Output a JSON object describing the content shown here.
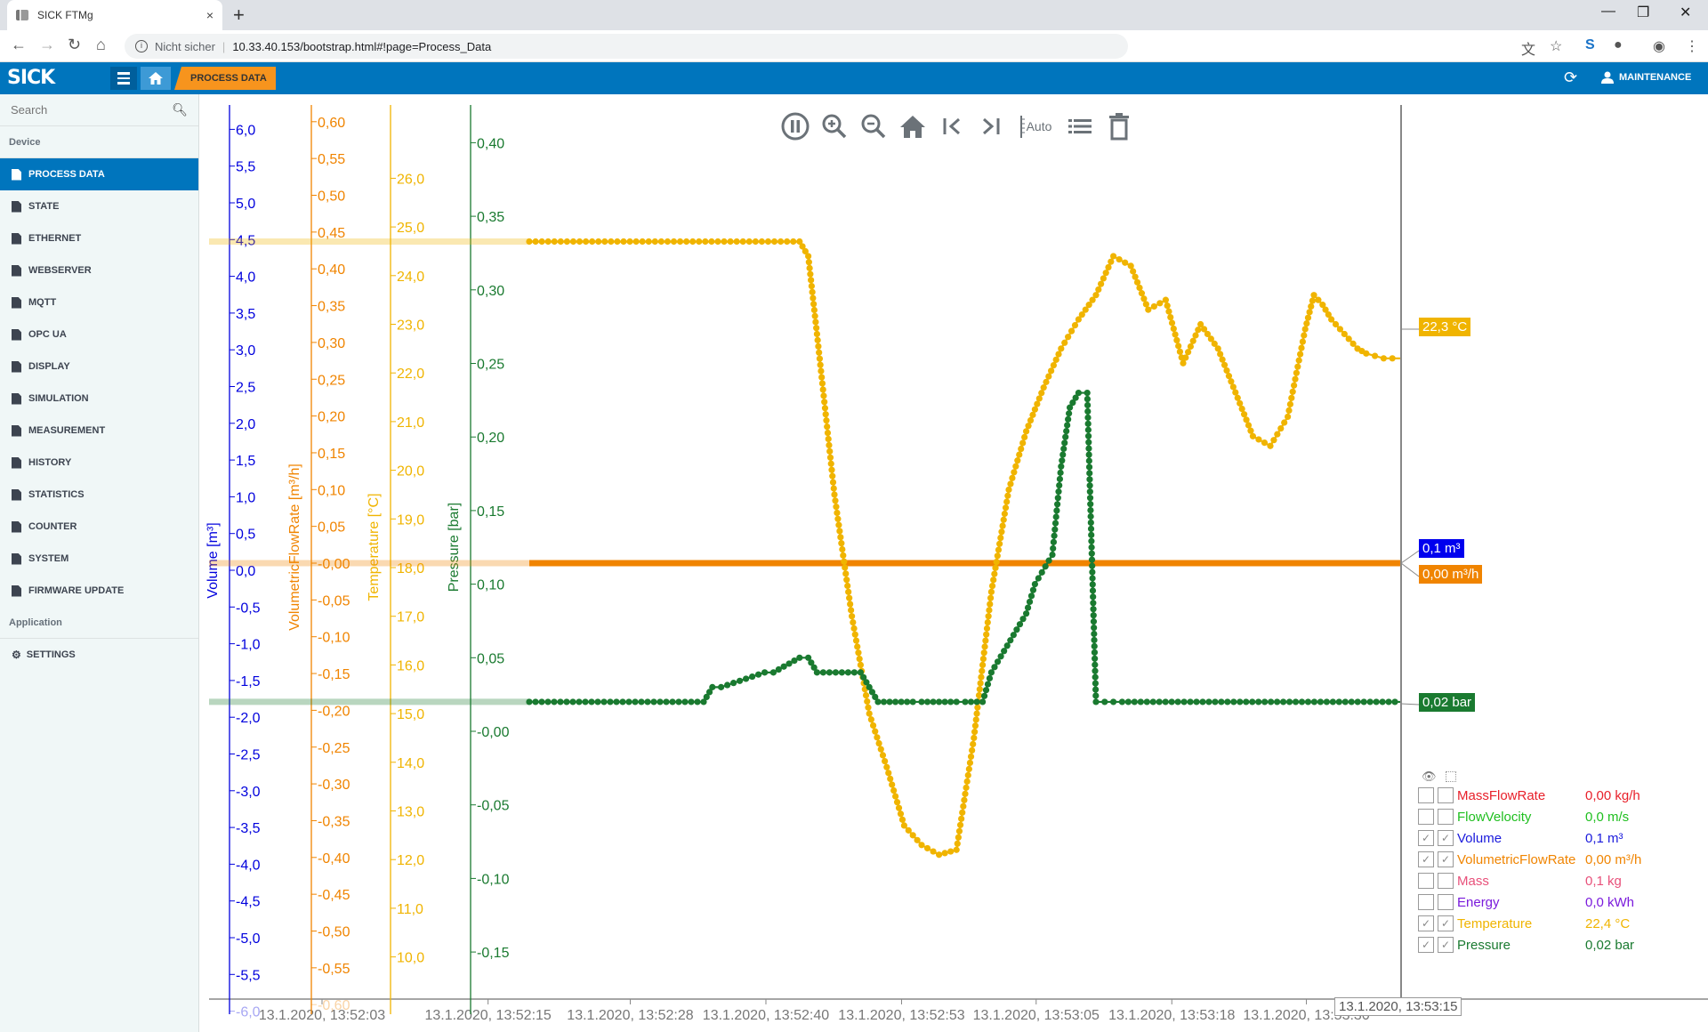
{
  "browser": {
    "tab_title": "SICK FTMg",
    "tab_close": "×",
    "new_tab": "+",
    "security_label": "Nicht sicher",
    "url": "10.33.40.153/bootstrap.html#!page=Process_Data",
    "window_controls": {
      "minimize": "—",
      "restore": "❐",
      "close": "✕"
    }
  },
  "header": {
    "logo": "SICK",
    "breadcrumb": "PROCESS DATA",
    "user_label": "MAINTENANCE"
  },
  "sidebar": {
    "search_placeholder": "Search",
    "device_section": "Device",
    "items": [
      {
        "label": "PROCESS DATA",
        "active": true
      },
      {
        "label": "STATE"
      },
      {
        "label": "ETHERNET"
      },
      {
        "label": "WEBSERVER"
      },
      {
        "label": "MQTT"
      },
      {
        "label": "OPC UA"
      },
      {
        "label": "DISPLAY"
      },
      {
        "label": "SIMULATION"
      },
      {
        "label": "MEASUREMENT"
      },
      {
        "label": "HISTORY"
      },
      {
        "label": "STATISTICS"
      },
      {
        "label": "COUNTER"
      },
      {
        "label": "SYSTEM"
      },
      {
        "label": "FIRMWARE UPDATE"
      }
    ],
    "application_section": "Application",
    "app_items": [
      {
        "label": "SETTINGS"
      }
    ]
  },
  "toolbar": {
    "auto_label": "Auto",
    "buttons": [
      "pause",
      "zoom-in",
      "zoom-out",
      "home",
      "jump-start",
      "jump-end",
      "auto-scale",
      "list",
      "delete"
    ]
  },
  "chart_data": {
    "type": "line",
    "xlabel": "",
    "x_ticks": [
      "13.1.2020, 13:52:03",
      "13.1.2020, 13:52:15",
      "13.1.2020, 13:52:28",
      "13.1.2020, 13:52:40",
      "13.1.2020, 13:52:53",
      "13.1.2020, 13:53:05",
      "13.1.2020, 13:53:18",
      "13.1.2020, 13:53:30"
    ],
    "x_range_seconds": [
      0,
      100
    ],
    "cursor_time": "13.1.2020, 13:53:15",
    "axes": [
      {
        "name": "Volume",
        "label": "Volume [m³]",
        "color": "#0000dd",
        "range": [
          -6.0,
          6.0
        ],
        "ticks": [
          "6,0",
          "5,5",
          "5,0",
          "4,5",
          "4,0",
          "3,5",
          "3,0",
          "2,5",
          "2,0",
          "1,5",
          "1,0",
          "0,5",
          "0,0",
          "-0,5",
          "-1,0",
          "-1,5",
          "-2,0",
          "-2,5",
          "-3,0",
          "-3,5",
          "-4,0",
          "-4,5",
          "-5,0",
          "-5,5",
          "-6,0"
        ]
      },
      {
        "name": "VolumetricFlowRate",
        "label": "VolumetricFlowRate [m³/h]",
        "color": "#f08400",
        "range": [
          -0.6,
          0.6
        ],
        "ticks": [
          "0,60",
          "0,55",
          "0,50",
          "0,45",
          "0,40",
          "0,35",
          "0,30",
          "0,25",
          "0,20",
          "0,15",
          "0,10",
          "0,05",
          "-0,00",
          "-0,05",
          "-0,10",
          "-0,15",
          "-0,20",
          "-0,25",
          "-0,30",
          "-0,35",
          "-0,40",
          "-0,45",
          "-0,50",
          "-0,55",
          "-0,60"
        ]
      },
      {
        "name": "Temperature",
        "label": "Temperature [°C]",
        "color": "#f0b400",
        "range": [
          10.0,
          26.0
        ],
        "ticks": [
          "26,0",
          "25,0",
          "24,0",
          "23,0",
          "22,0",
          "21,0",
          "20,0",
          "19,0",
          "18,0",
          "17,0",
          "16,0",
          "15,0",
          "14,0",
          "13,0",
          "12,0",
          "11,0",
          "10,0"
        ]
      },
      {
        "name": "Pressure",
        "label": "Pressure [bar]",
        "color": "#1a7a30",
        "range": [
          -0.15,
          0.4
        ],
        "ticks": [
          "0,40",
          "0,35",
          "0,30",
          "0,25",
          "0,20",
          "0,15",
          "0,10",
          "0,05",
          "-0,00",
          "-0,05",
          "-0,10",
          "-0,15"
        ]
      }
    ],
    "series": [
      {
        "name": "Volume",
        "axis": "Volume",
        "color": "#0000dd",
        "t": [
          0,
          100
        ],
        "values": [
          0.1,
          0.1
        ]
      },
      {
        "name": "VolumetricFlowRate",
        "axis": "VolumetricFlowRate",
        "color": "#f08400",
        "t": [
          0,
          100
        ],
        "values": [
          0.0,
          0.0
        ]
      },
      {
        "name": "Temperature",
        "axis": "Temperature",
        "color": "#f0b400",
        "t": [
          0,
          31,
          32,
          33,
          35,
          37,
          39,
          41,
          43,
          45,
          47,
          49,
          51,
          53,
          55,
          57,
          59,
          61,
          63,
          65,
          67,
          69,
          71,
          73,
          75,
          77,
          79,
          81,
          83,
          85,
          87,
          88,
          89,
          90,
          91,
          92,
          93,
          94,
          95,
          96,
          97,
          98,
          99,
          100
        ],
        "values": [
          24.7,
          24.7,
          24.4,
          22.8,
          19.5,
          17.0,
          15.0,
          13.9,
          12.7,
          12.3,
          12.1,
          12.2,
          14.5,
          17.5,
          19.6,
          20.8,
          21.7,
          22.5,
          23.1,
          23.6,
          24.4,
          24.2,
          23.3,
          23.5,
          22.2,
          23.0,
          22.5,
          21.6,
          20.7,
          20.5,
          21.1,
          22.0,
          22.9,
          23.6,
          23.4,
          23.1,
          22.9,
          22.7,
          22.5,
          22.4,
          22.35,
          22.3,
          22.3,
          22.3
        ]
      },
      {
        "name": "Pressure",
        "axis": "Pressure",
        "color": "#1a7a30",
        "t": [
          0,
          20,
          21,
          22,
          27,
          28,
          31,
          32,
          33,
          38,
          39,
          40,
          44,
          45,
          49,
          50,
          52,
          53,
          57,
          58,
          60,
          61,
          62,
          63,
          64,
          65,
          66,
          67,
          68,
          100
        ],
        "values": [
          0.02,
          0.02,
          0.03,
          0.03,
          0.04,
          0.04,
          0.05,
          0.05,
          0.04,
          0.04,
          0.03,
          0.02,
          0.02,
          0.02,
          0.02,
          0.02,
          0.02,
          0.04,
          0.08,
          0.1,
          0.12,
          0.18,
          0.22,
          0.23,
          0.23,
          0.02,
          0.02,
          0.02,
          0.02,
          0.02
        ]
      }
    ],
    "value_labels": [
      {
        "series": "Temperature",
        "text": "22,3 °C",
        "color": "#f0b400"
      },
      {
        "series": "Volume",
        "text": "0,1 m³",
        "color": "#0000ee"
      },
      {
        "series": "VolumetricFlowRate",
        "text": "0,00 m³/h",
        "color": "#f08400"
      },
      {
        "series": "Pressure",
        "text": "0,02 bar",
        "color": "#1a7a30"
      }
    ]
  },
  "legend": {
    "rows": [
      {
        "name": "MassFlowRate",
        "value": "0,00 kg/h",
        "color": "#e8202a",
        "visible": false,
        "autoscale": false
      },
      {
        "name": "FlowVelocity",
        "value": "0,0 m/s",
        "color": "#1fbf1f",
        "visible": false,
        "autoscale": false
      },
      {
        "name": "Volume",
        "value": "0,1 m³",
        "color": "#1a1adc",
        "visible": true,
        "autoscale": true
      },
      {
        "name": "VolumetricFlowRate",
        "value": "0,00 m³/h",
        "color": "#f08400",
        "visible": true,
        "autoscale": true
      },
      {
        "name": "Mass",
        "value": "0,1 kg",
        "color": "#e8507a",
        "visible": false,
        "autoscale": false
      },
      {
        "name": "Energy",
        "value": "0,0 kWh",
        "color": "#7a1adc",
        "visible": false,
        "autoscale": false
      },
      {
        "name": "Temperature",
        "value": "22,4 °C",
        "color": "#f0b400",
        "visible": true,
        "autoscale": true
      },
      {
        "name": "Pressure",
        "value": "0,02 bar",
        "color": "#1a7a30",
        "visible": true,
        "autoscale": true
      }
    ]
  }
}
